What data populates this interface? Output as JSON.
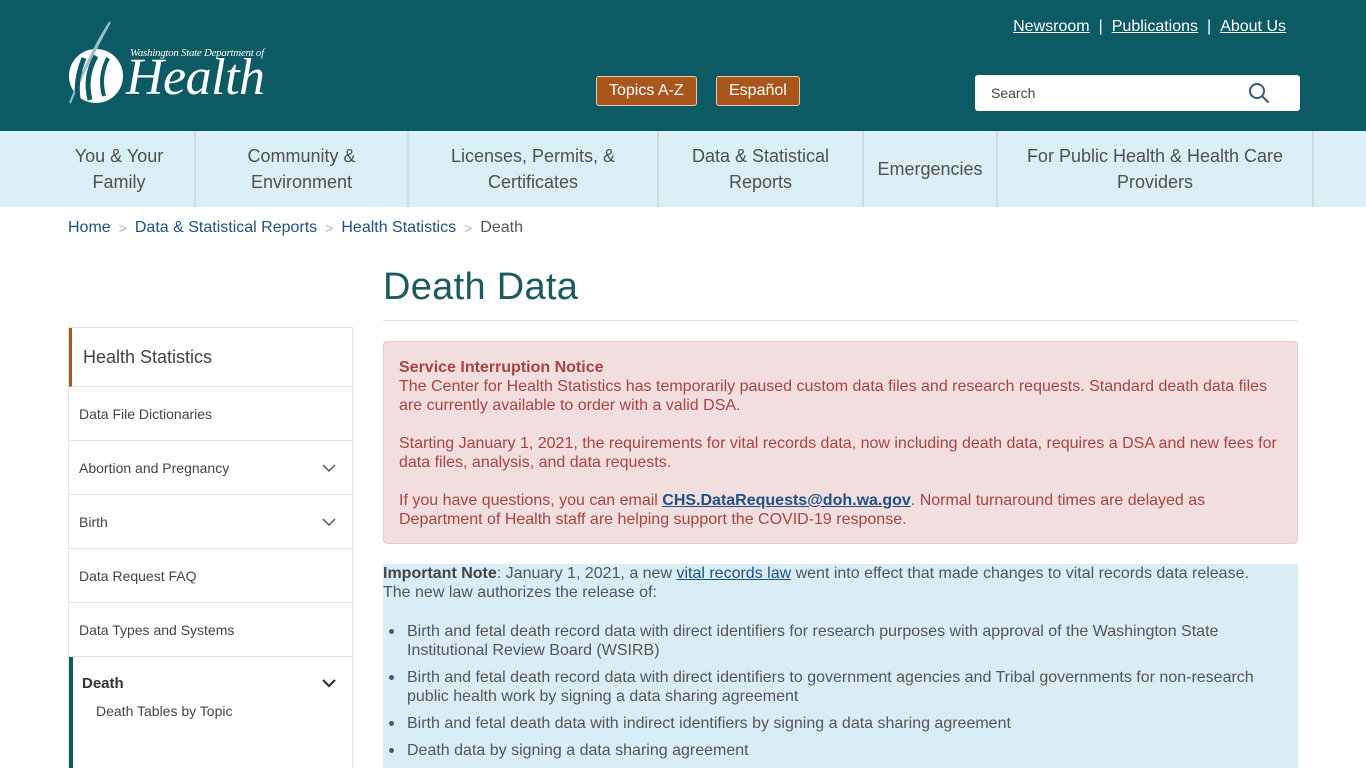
{
  "header": {
    "logo": {
      "small_text": "Washington State Department of",
      "big_text": "Health"
    },
    "top_links": [
      "Newsroom",
      "Publications",
      "About Us"
    ],
    "separator": "|",
    "buttons": {
      "topics": "Topics A-Z",
      "espanol": "Español"
    },
    "search": {
      "placeholder": "Search",
      "icon": "search-icon"
    }
  },
  "nav": {
    "items": [
      "You & Your Family",
      "Community & Environment",
      "Licenses, Permits, & Certificates",
      "Data & Statistical Reports",
      "Emergencies",
      "For Public Health & Health Care Providers"
    ]
  },
  "breadcrumb": {
    "items": [
      "Home",
      "Data & Statistical Reports",
      "Health Statistics"
    ],
    "current": "Death",
    "separator": ">"
  },
  "page": {
    "title": "Death Data"
  },
  "sidebar": {
    "heading": "Health Statistics",
    "items": [
      {
        "label": "Data File Dictionaries",
        "expandable": false
      },
      {
        "label": "Abortion and Pregnancy",
        "expandable": true
      },
      {
        "label": "Birth",
        "expandable": true
      },
      {
        "label": "Data Request FAQ",
        "expandable": false
      },
      {
        "label": "Data Types and Systems",
        "expandable": false
      }
    ],
    "active": {
      "label": "Death",
      "expanded": true,
      "children": [
        "Death Tables by Topic"
      ]
    }
  },
  "alert": {
    "heading": "Service Interruption Notice",
    "p1": "The Center for Health Statistics has temporarily paused custom data files and research requests. Standard death data files are currently available to order with a valid DSA.",
    "p2": "Starting January 1, 2021, the requirements for vital records data, now including death data, requires a DSA and new fees for data files, analysis, and data requests.",
    "p3_before": "If you have questions, you can email ",
    "p3_link": "CHS.DataRequests@doh.wa.gov",
    "p3_after": ". Normal turnaround times are delayed as Department of Health staff are helping support the COVID-19 response."
  },
  "info": {
    "label": "Important Note",
    "text_before": ": January 1, 2021, a new ",
    "link": "vital records law",
    "text_after": " went into effect that made changes to vital records data release. The new law authorizes the release of:",
    "bullets": [
      "Birth and fetal death record data with direct identifiers for research purposes with approval of the Washington State Institutional Review Board (WSIRB)",
      "Birth and fetal death record data with direct identifiers to government agencies and Tribal governments for non-research public health work by signing a data sharing agreement",
      "Birth and fetal death data with indirect identifiers by signing a data sharing agreement",
      "Death data by signing a data sharing agreement"
    ]
  },
  "colors": {
    "header_bg": "#0b5a64",
    "nav_bg": "#daeff6",
    "button_bg": "#a8561b",
    "alert_bg": "#f2dede",
    "alert_text": "#a94442",
    "info_bg": "#d9edf7",
    "link": "#1e5282"
  }
}
